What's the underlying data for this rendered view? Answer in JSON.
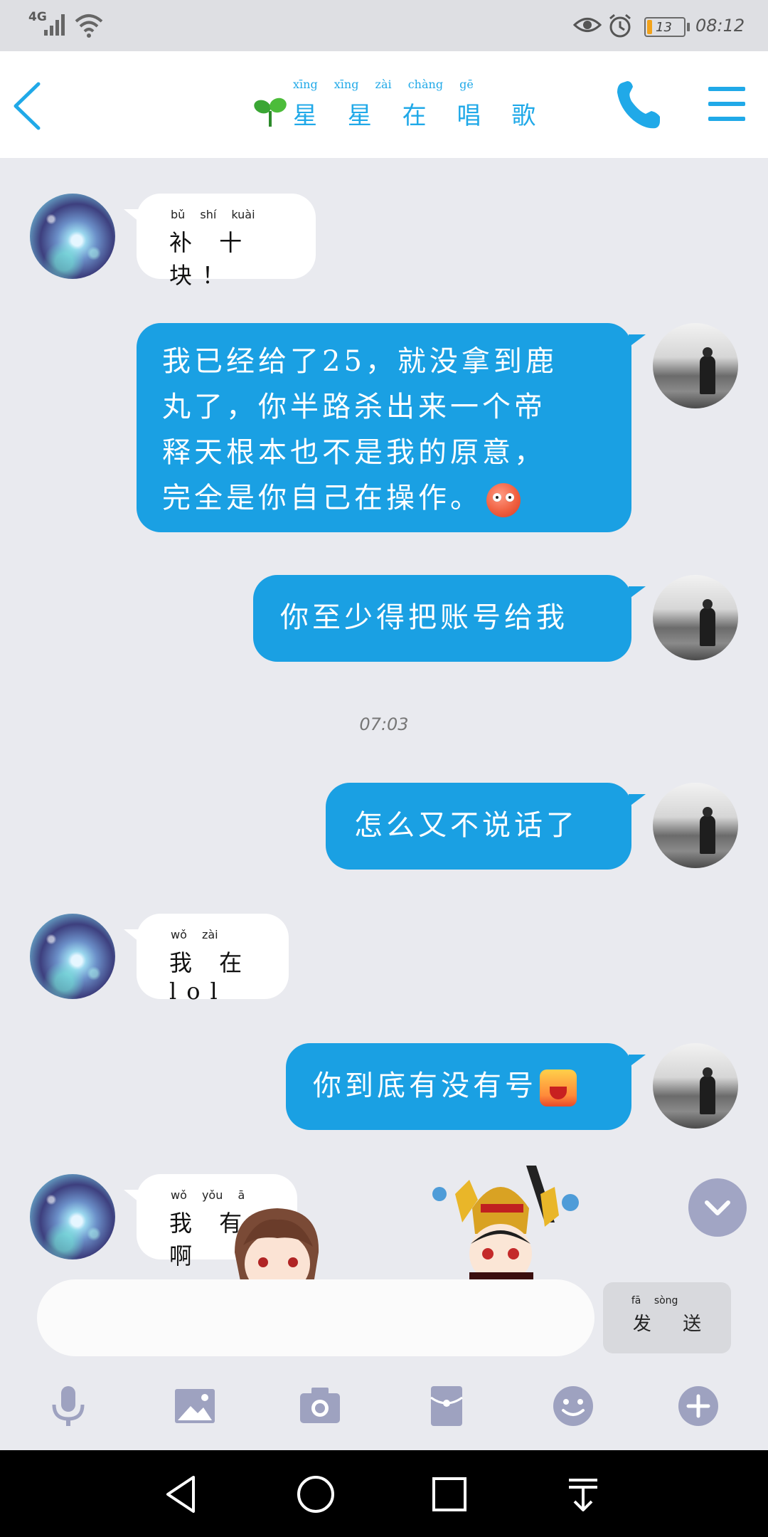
{
  "status_bar": {
    "network": "4G",
    "battery": "13",
    "time": "08:12"
  },
  "header": {
    "title": "星 星 在 唱 歌",
    "title_pinyin": "xīng xīng zài chàng gē"
  },
  "messages": [
    {
      "side": "in",
      "pinyin": "bǔ shí kuài",
      "text": "补 十 块！"
    },
    {
      "side": "out",
      "lines": [
        "我已经给了25，就没拿到鹿",
        "丸了，你半路杀出来一个帝",
        "释天根本也不是我的原意，",
        "完全是你自己在操作。"
      ],
      "emoji": "red-surprised-face-emoji"
    },
    {
      "side": "out",
      "text": "你至少得把账号给我"
    },
    {
      "side": "out",
      "text": "怎么又不说话了"
    },
    {
      "side": "in",
      "pinyin": "wǒ zài",
      "text": "我 在 lol"
    },
    {
      "side": "out",
      "text": "你到底有没有号",
      "emoji": "rage-face-emoji"
    },
    {
      "side": "in",
      "pinyin": "wǒ yǒu ā",
      "text": "我 有 啊"
    }
  ],
  "timestamp": "07:03",
  "input": {
    "placeholder": "",
    "send_label": "发 送",
    "send_pinyin": "fā sòng"
  },
  "toolbar_icons": [
    "microphone-icon",
    "image-icon",
    "camera-icon",
    "red-packet-icon",
    "emoji-icon",
    "plus-icon"
  ],
  "colors": {
    "accent": "#1aa0e3",
    "background": "#e9eaef",
    "incoming_bubble": "#ffffff",
    "nav_bar": "#000000"
  }
}
